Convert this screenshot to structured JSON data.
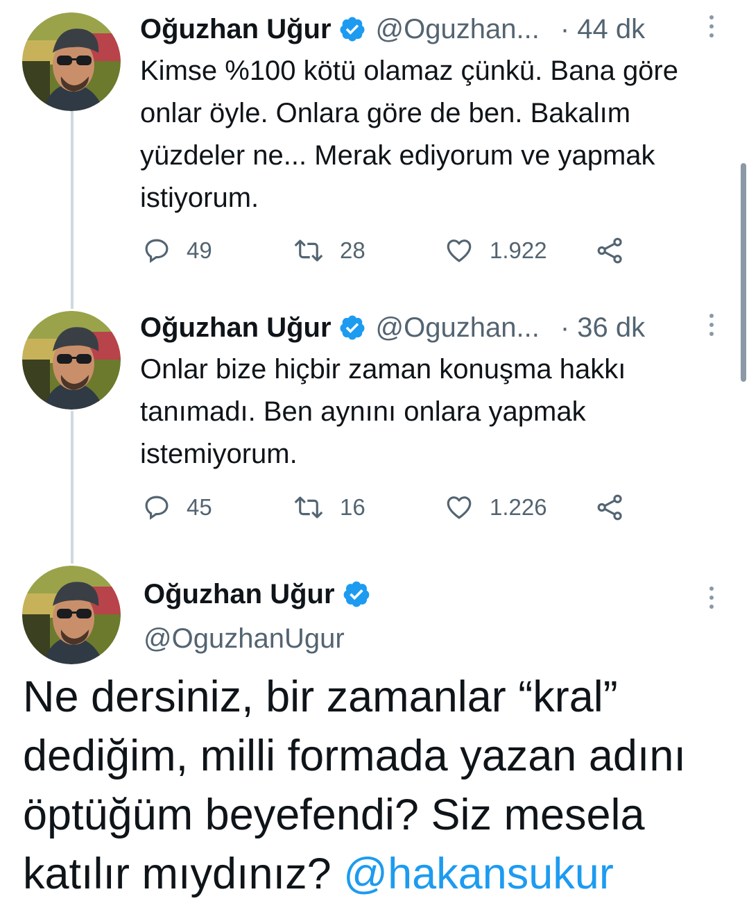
{
  "tweets": [
    {
      "name": "Oğuzhan Uğur",
      "handle": "@Oguzhan...",
      "time": "· 44 dk",
      "text": "Kimse %100 kötü olamaz çünkü. Bana göre onlar öyle. Onlara göre de ben. Bakalım yüzdeler ne... Merak ediyorum ve yapmak istiyorum.",
      "replies": "49",
      "retweets": "28",
      "likes": "1.922"
    },
    {
      "name": "Oğuzhan Uğur",
      "handle": "@Oguzhan...",
      "time": "· 36 dk",
      "text": "Onlar bize hiçbir zaman konuşma hakkı tanımadı. Ben aynını onlara yapmak istemiyorum.",
      "replies": "45",
      "retweets": "16",
      "likes": "1.226"
    }
  ],
  "main_tweet": {
    "name": "Oğuzhan Uğur",
    "handle": "@OguzhanUgur",
    "text": "Ne dersiniz, bir zamanlar “kral” dediğim, milli formada yazan adını öptüğüm beyefendi? Siz mesela katılır mıydınız?",
    "mention": "@hakansukur"
  },
  "icons": {
    "verified": "verified-badge-icon",
    "reply": "reply-icon",
    "retweet": "retweet-icon",
    "like": "heart-icon",
    "share": "share-icon",
    "more": "more-icon"
  },
  "colors": {
    "accent": "#1d9bf0",
    "secondary_text": "#536471",
    "thread_line": "#cfd9de"
  }
}
